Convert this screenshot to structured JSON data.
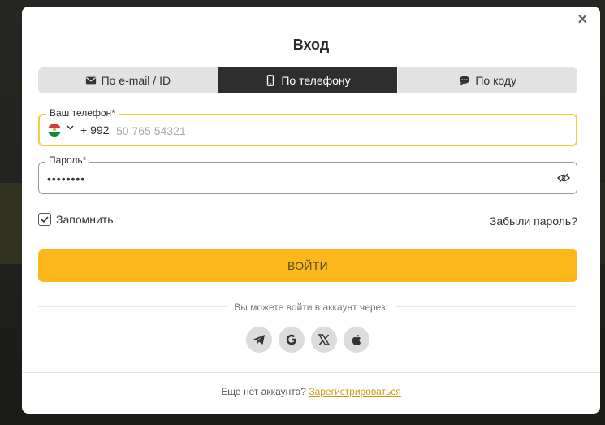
{
  "modal": {
    "title": "Вход",
    "close_glyph": "×"
  },
  "tabs": [
    {
      "label": "По e-mail / ID",
      "icon": "envelope-icon",
      "active": false
    },
    {
      "label": "По телефону",
      "icon": "mobile-phone-icon",
      "active": true
    },
    {
      "label": "По коду",
      "icon": "chat-bubble-icon",
      "active": false
    }
  ],
  "phone_field": {
    "label": "Ваш телефон*",
    "country_code": "+ 992",
    "placeholder": "50 765 54321",
    "value": "",
    "flag": "tajikistan-flag-icon"
  },
  "password_field": {
    "label": "Пароль*",
    "value": "••••••••"
  },
  "remember": {
    "label": "Запомнить",
    "checked": true
  },
  "forgot_password": "Забыли пароль?",
  "login_button": "ВОЙТИ",
  "social_login_text": "Вы можете войти в аккаунт через:",
  "social_providers": [
    "telegram-icon",
    "google-icon",
    "x-icon",
    "apple-icon"
  ],
  "footer": {
    "text": "Еще нет аккаунта?",
    "link": "Зарегистрироваться"
  },
  "colors": {
    "accent": "#fcb71b",
    "active_tab": "#2e2e2e",
    "focus_border": "#f2cf3b",
    "link": "#c79b10"
  }
}
